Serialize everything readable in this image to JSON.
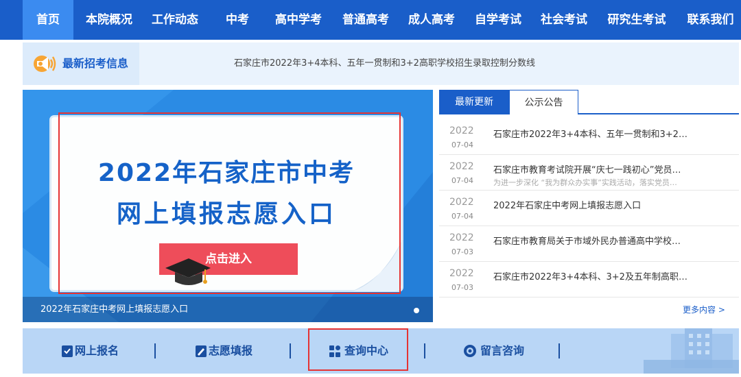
{
  "nav": {
    "items": [
      {
        "label": "首页",
        "active": true
      },
      {
        "label": "本院概况"
      },
      {
        "label": "工作动态"
      },
      {
        "label": "中考"
      },
      {
        "label": "高中学考"
      },
      {
        "label": "普通高考"
      },
      {
        "label": "成人高考"
      },
      {
        "label": "自学考试"
      },
      {
        "label": "社会考试"
      },
      {
        "label": "研究生考试"
      },
      {
        "label": "联系我们"
      }
    ]
  },
  "ticker": {
    "label": "最新招考信息",
    "text": "石家庄市2022年3+4本科、五年一贯制和3+2高职学校招生录取控制分数线"
  },
  "banner": {
    "line1": "2022年石家庄市中考",
    "line2": "网上填报志愿入口",
    "button": "点击进入",
    "caption": "2022年石家庄中考网上填报志愿入口"
  },
  "news": {
    "tabs": [
      "最新更新",
      "公示公告"
    ],
    "items": [
      {
        "year": "2022",
        "date": "07-04",
        "title": "石家庄市2022年3+4本科、五年一贯制和3+2…",
        "sub": ""
      },
      {
        "year": "2022",
        "date": "07-04",
        "title": "石家庄市教育考试院开展“庆七一践初心”党员…",
        "sub": "为进一步深化 “我为群众办实事”实践活动，落实党员…"
      },
      {
        "year": "2022",
        "date": "07-04",
        "title": "2022年石家庄中考网上填报志愿入口",
        "sub": ""
      },
      {
        "year": "2022",
        "date": "07-03",
        "title": "石家庄市教育局关于市域外民办普通高中学校…",
        "sub": ""
      },
      {
        "year": "2022",
        "date": "07-03",
        "title": "石家庄市2022年3+4本科、3+2及五年制高职…",
        "sub": ""
      }
    ],
    "more": "更多内容 >"
  },
  "quick": {
    "items": [
      "网上报名",
      "志愿填报",
      "查询中心",
      "留言咨询"
    ]
  },
  "colors": {
    "nav": "#1a5ec9",
    "nav_active": "#3b8bf0",
    "highlight_frame": "#e53232",
    "button": "#ee4d5a"
  }
}
